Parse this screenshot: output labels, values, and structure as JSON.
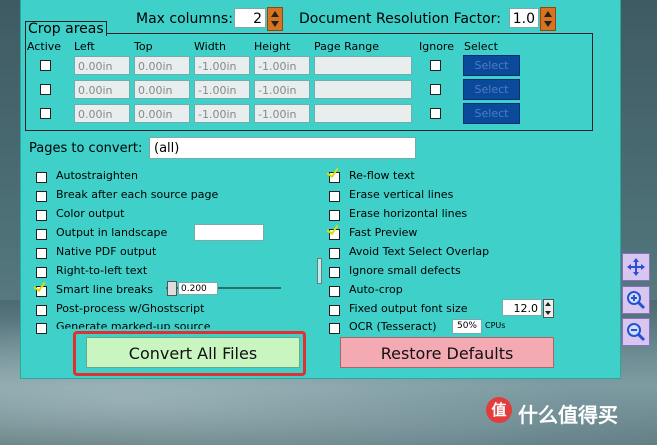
{
  "top": {
    "max_columns_label": "Max columns:",
    "max_columns_value": "2",
    "doc_res_label": "Document Resolution Factor:",
    "doc_res_value": "1.0"
  },
  "crop": {
    "title": "Crop areas",
    "headers": [
      "Active",
      "Left",
      "Top",
      "Width",
      "Height",
      "Page Range",
      "Ignore",
      "Select"
    ],
    "rows": [
      {
        "left": "0.00in",
        "top": "0.00in",
        "width": "-1.00in",
        "height": "-1.00in",
        "select": "Select"
      },
      {
        "left": "0.00in",
        "top": "0.00in",
        "width": "-1.00in",
        "height": "-1.00in",
        "select": "Select"
      },
      {
        "left": "0.00in",
        "top": "0.00in",
        "width": "-1.00in",
        "height": "-1.00in",
        "select": "Select"
      }
    ]
  },
  "pages": {
    "label": "Pages to convert:",
    "value": "(all)"
  },
  "left_options": [
    {
      "label": "Autostraighten",
      "checked": false
    },
    {
      "label": "Break after each source page",
      "checked": false
    },
    {
      "label": "Color output",
      "checked": false
    },
    {
      "label": "Output in landscape",
      "checked": false
    },
    {
      "label": "Native PDF output",
      "checked": false
    },
    {
      "label": "Right-to-left text",
      "checked": false
    },
    {
      "label": "Smart line breaks",
      "checked": true,
      "value": "0.200"
    },
    {
      "label": "Post-process w/Ghostscript",
      "checked": false
    },
    {
      "label": "Generate marked-up source",
      "checked": false
    }
  ],
  "right_options": [
    {
      "label": "Re-flow text",
      "checked": true
    },
    {
      "label": "Erase vertical lines",
      "checked": false
    },
    {
      "label": "Erase horizontal lines",
      "checked": false
    },
    {
      "label": "Fast Preview",
      "checked": true
    },
    {
      "label": "Avoid Text Select Overlap",
      "checked": false
    },
    {
      "label": "Ignore small defects",
      "checked": false
    },
    {
      "label": "Auto-crop",
      "checked": false
    },
    {
      "label": "Fixed output font size",
      "checked": false,
      "value": "12.0"
    },
    {
      "label": "OCR (Tesseract)",
      "checked": false,
      "value": "50%",
      "unit": "CPUs"
    }
  ],
  "buttons": {
    "convert": "Convert All Files",
    "restore": "Restore Defaults"
  },
  "colors": {
    "panel": "#3ed0c9",
    "convert_bg": "#c8f5c0",
    "restore_bg": "#f4aab2",
    "highlight": "#e03030",
    "select_bg": "#0b4a9a"
  },
  "watermark": "值 什么值得买"
}
